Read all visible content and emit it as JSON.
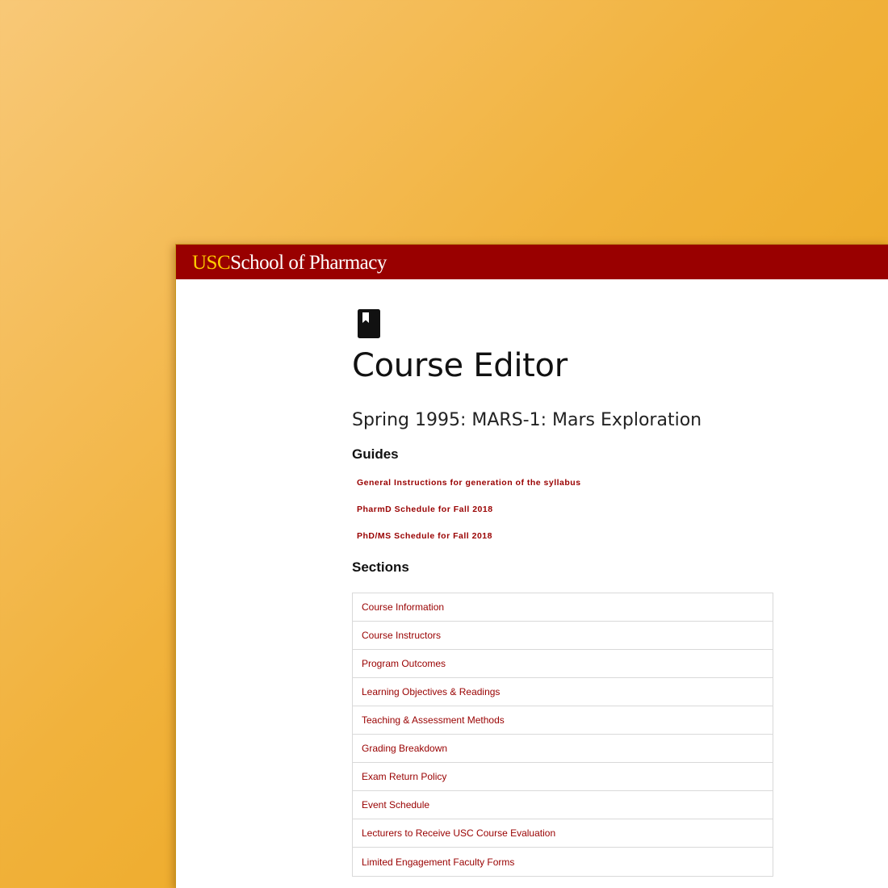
{
  "brand": {
    "usc": "USC",
    "school": "School of Pharmacy",
    "bar_color": "#990000",
    "usc_color": "#ffcc00"
  },
  "page": {
    "icon": "book-icon",
    "title": "Course Editor",
    "course_title": "Spring 1995: MARS-1: Mars Exploration"
  },
  "guides": {
    "heading": "Guides",
    "items": [
      "General Instructions for generation of the syllabus",
      "PharmD Schedule for Fall 2018",
      "PhD/MS Schedule for Fall 2018"
    ]
  },
  "sections": {
    "heading": "Sections",
    "items": [
      "Course Information",
      "Course Instructors",
      "Program Outcomes",
      "Learning Objectives & Readings",
      "Teaching & Assessment Methods",
      "Grading Breakdown",
      "Exam Return Policy",
      "Event Schedule",
      "Lecturers to Receive USC Course Evaluation",
      "Limited Engagement Faculty Forms"
    ]
  }
}
